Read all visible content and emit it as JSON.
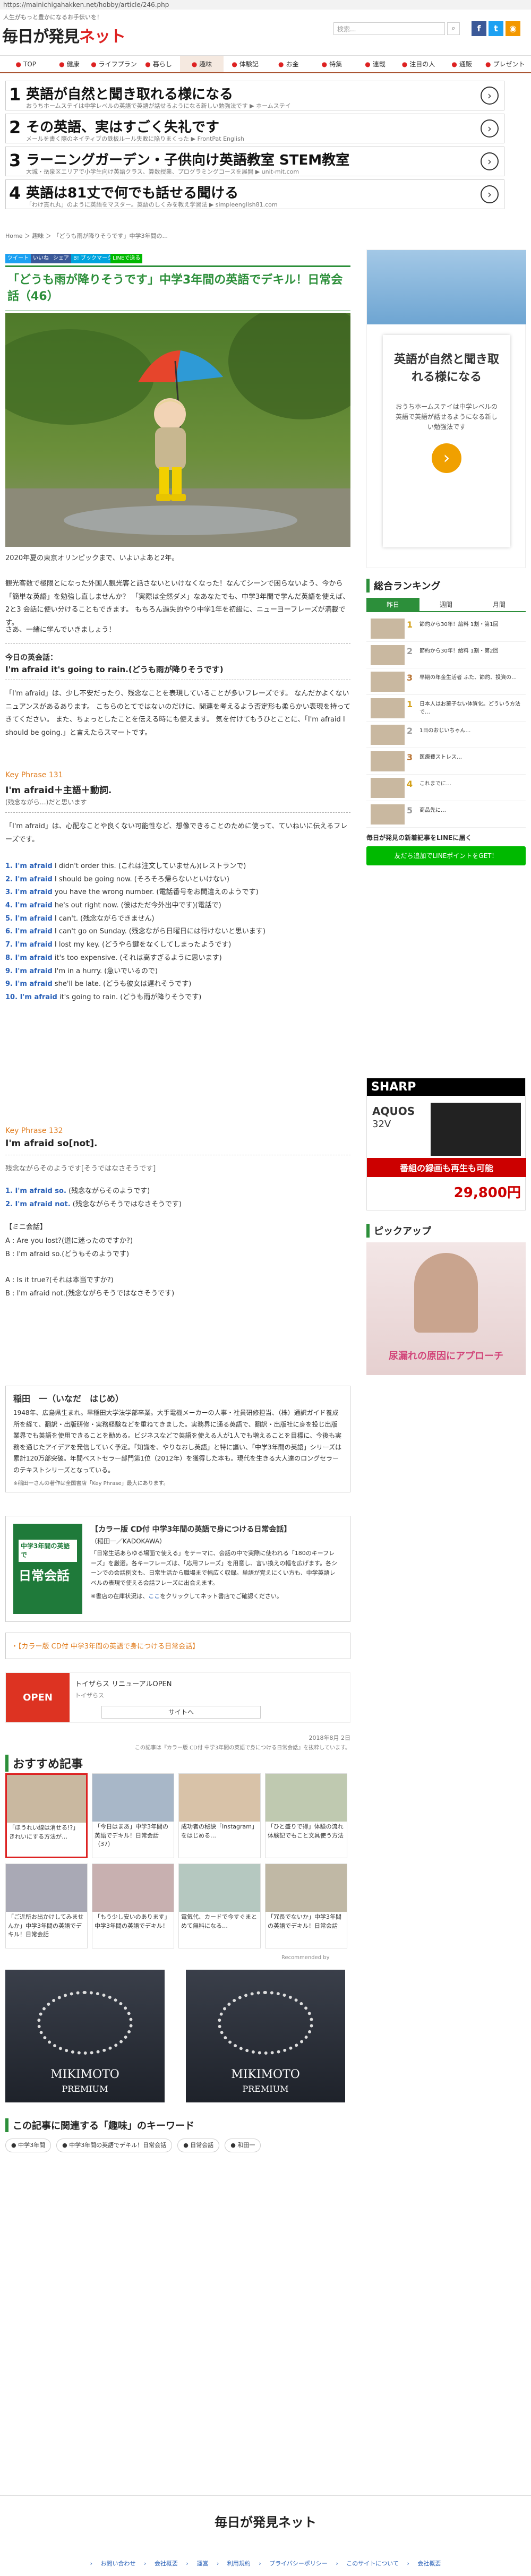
{
  "browser": {
    "url": "https://mainichigahakken.net/hobby/article/246.php"
  },
  "header": {
    "tagline": "人生がもっと豊かになるお手伝いを！",
    "logo_main": "毎日が発見",
    "logo_net": "ネット",
    "search_placeholder": "検索..."
  },
  "nav": {
    "items": [
      "TOP",
      "健康",
      "ライフプラン",
      "暮らし",
      "趣味",
      "体験記",
      "お金",
      "特集",
      "連載",
      "注目の人",
      "通販",
      "プレゼント"
    ],
    "active_index": 4
  },
  "ads": [
    {
      "num": "1",
      "title": "英語が自然と聞き取れる様になる",
      "sub": "おうちホームステイは中学レベルの英語で英語が話せるようになる新しい勉強法です ▶ ホームステイ"
    },
    {
      "num": "2",
      "title": "その英語、実はすごく失礼です",
      "sub": "メールを書く際のネイティブの鉄板ルール失敗に陥りまくった ▶ FrontPat English"
    },
    {
      "num": "3",
      "title": "ラーニングガーデン・子供向け英語教室 STEM教室",
      "sub": "大城・岳泉区エリアで小学生向け英語クラス、算数授業、プログラミングコースを展開 ▶ unit-mit.com"
    },
    {
      "num": "4",
      "title": "英語は81丈で何でも話せる聞ける",
      "sub": "「わけ貫れ丸」のように英語をマスター。英語のしくみを教え学習法 ▶ simpleenglish81.com"
    }
  ],
  "breadcrumb": "Home ＞ 趣味 ＞ 「どうも雨が降りそうです」中学3年間の...",
  "share": {
    "tweet": "ツイート",
    "like": "いいね",
    "share": "シェア",
    "hatena": "B! ブックマーク",
    "line": "LINEで送る"
  },
  "article": {
    "title": "「どうも雨が降りそうです」中学3年間の英語でデキル！日常会話（46）",
    "intro1": "2020年夏の東京オリンピックまで、いよいよあと2年。",
    "intro2": "観光客数で極限とになった外国人観光客と話さないといけなくなった！なんてシーンで困らないよう、今から「簡単な英語」を勉強し直しませんか？ 「実際は全然ダメ」なあなたでも、中学3年間で学んだ英語を使えば、2と3 会話に使い分けることもできます。 もちろん過失的やり中学1年を初級に、ニューヨーフレーズが満載です。",
    "intro3": "さあ、一緒に学んでいきましょう！",
    "today_label": "今日の英会話：",
    "today_phrase": "I'm afraid it's going to rain.(どうも雨が降りそうです)",
    "expl1": "「I'm afraid」は、少し不安だったり、残念なことを表現していることが多いフレーズです。 なんだかよくないニュアンスがあるあります。 こちらのとてではないのだけに、関連を考えるよう否定形も柔らかい表現を持ってきてください。 また、ちょっとしたことを伝える時にも使えます。 気を付けてもうひとことに、「I'm afraid I should be going.」と言えたらスマートです。",
    "kp131": "Key Phrase 131",
    "kp131_head": "I'm afraid＋主語＋動詞.",
    "kp131_sub": "(残念ながら…)だと思います",
    "kp131_expl": "「I'm afraid」は、心配なことや良くない可能性など、想像できることのために使って、ていねいに伝えるフレーズです。",
    "examples131": [
      {
        "num": "1.",
        "en": "I'm afraid",
        "rest": " I didn't order this. (これは注文していません)(レストランで)"
      },
      {
        "num": "2.",
        "en": "I'm afraid",
        "rest": " I should be going now. (そろそろ帰らないといけない)"
      },
      {
        "num": "3.",
        "en": "I'm afraid",
        "rest": " you have the wrong number. (電話番号をお間違えのようです)"
      },
      {
        "num": "4.",
        "en": "I'm afraid",
        "rest": " he's out right now. (彼はただ今外出中です)(電話で)"
      },
      {
        "num": "5.",
        "en": "I'm afraid",
        "rest": " I can't. (残念ながらできません)"
      },
      {
        "num": "6.",
        "en": "I'm afraid",
        "rest": " I can't go on Sunday. (残念ながら日曜日には行けないと思います)"
      },
      {
        "num": "7.",
        "en": "I'm afraid",
        "rest": " I lost my key. (どうやら鍵をなくしてしまったようです)"
      },
      {
        "num": "8.",
        "en": "I'm afraid",
        "rest": " it's too expensive. (それは高すぎるように思います)"
      },
      {
        "num": "9.",
        "en": "I'm afraid",
        "rest": " I'm in a hurry. (急いでいるので)"
      },
      {
        "num": "9.",
        "en": "I'm afraid",
        "rest": " she'll be late. (どうも彼女は遅れそうです)"
      },
      {
        "num": "10.",
        "en": "I'm afraid",
        "rest": " it's going to rain. (どうも雨が降りそうです)"
      }
    ],
    "kp132": "Key Phrase 132",
    "kp132_head": "I'm afraid so[not].",
    "kp132_sub": "残念ながらそのようです[そうではなさそうです]",
    "examples132": [
      {
        "num": "1.",
        "en": "I'm afraid so.",
        "rest": " (残念ながらそのようです)"
      },
      {
        "num": "2.",
        "en": "I'm afraid not.",
        "rest": " (残念ながらそうではなさそうです)"
      }
    ],
    "dialog_label": "【ミニ会話】",
    "dialog": [
      "A : Are you lost?(道に迷ったのですか?)",
      "B : I'm afraid so.(どうもそのようです)",
      "",
      "A : Is it true?(それは本当ですか?)",
      "B : I'm afraid not.(残念ながらそうではなさそうです)"
    ]
  },
  "author": {
    "name": "稲田　一（いなだ　はじめ）",
    "bio": "1948年、広島県生まれ。早稲田大学法学部卒業。大手電機メーカーの人事・社員研修担当、（株）通訳ガイド養成所を経て、翻訳・出版研修・実務経験などを重ねてきました。実務界に通る英語で、翻訳・出版社に身を投じ出版業界でも英語を使用できることを勧める。ビジネスなどで英語を使える人が1人でも増えることを目標に、今後も実務を通じたアイデアを発信していく予定。「知識を、やりなおし英語」と特に謳い、「中学3年間の英語」シリーズは累計120万部突破。年間ベストセラー部門第1位（2012年）を獲得した本も。現代を生きる大人達のロングセラーのテキストシリーズとなっている。",
    "note": "※稲田一さんの著作は全国書店「Key Phrase」最大にあります。"
  },
  "book": {
    "title": "【カラー版 CD付 中学3年間の英語で身につける日常会話】",
    "meta": "（稲田一／KADOKAWA）",
    "desc": "「日常生活あらゆる場面で使える」をテーマに、会話の中で実際に使われる「180のキーフレーズ」を厳選。各キーフレーズは、「応用フレーズ」を用意し、言い換えの幅を広げます。各シーンでの会話例文も、日常生活から職場まで幅広く収録。単語が覚えにくい方も、中学英語レベルの表現で使える会話フレーズに出会えます。",
    "link_pre": "※書店の在庫状況は、",
    "link": "ここ",
    "link_post": "をクリックしてネット書店でご確認ください。"
  },
  "related_link": "・【カラー版 CD付 中学3年間の英語で身につける日常会話】",
  "banner": {
    "title": "トイザらス リニューアルOPEN",
    "sub": "トイザらス",
    "cta": "サイトへ"
  },
  "date": "2018年8月 2日",
  "date_note": "この記事は『カラー版 CD付 中学3年間の英語で身につける日常会話』を抜粋しています。",
  "recommend": {
    "title": "おすすめ記事",
    "items": [
      "「ほうれい線は消せる!?」きれいにする方法が…",
      "「今日はまあ」中学3年間の英語でデキル！日常会話（37）",
      "成功者の秘訣「Instagram」をはじめる…",
      "「ひと盛りで得」体験の流れ体験記でもこと文具使う方法",
      "「ご近所お出かけしてみませんか」中学3年間の英語でデキル！日常会話",
      "「もう少し安いのあります」中学3年間の英語でデキル！",
      "電気代、カードで今すぐまとめて無料になる…",
      "「冗長でないか」中学3年間の英語でデキル！日常会話"
    ],
    "footer": "Recommended by"
  },
  "luxury_ads": [
    {
      "brand": "MIKIMOTO",
      "sub": "PREMIUM"
    },
    {
      "brand": "MIKIMOTO",
      "sub": "PREMIUM"
    }
  ],
  "keywords": {
    "title": "この記事に関連する「趣味」のキーワード",
    "items": [
      "中学3年間",
      "中学3年間の英語でデキル！日常会話",
      "日常会話",
      "和田一"
    ]
  },
  "side_ad": {
    "headline": "英語が自然と聞き取れる様になる",
    "body": "おうちホームステイは中学レベルの英語で英語が話せるようになる新しい勉強法です",
    "cta": "›"
  },
  "ranking": {
    "title": "総合ランキング",
    "tabs": [
      "昨日",
      "週間",
      "月間"
    ],
    "items": [
      {
        "rank": "1",
        "text": "節約から30年！給料 1割・第1回"
      },
      {
        "rank": "2",
        "text": "節約から30年！給料 1割・第2回"
      },
      {
        "rank": "3",
        "text": "早期の年金生活者 ふた、節約、投資の…"
      },
      {
        "rank": "1",
        "text": "日本人はお菓子ない体質化。どういう方法で…"
      },
      {
        "rank": "2",
        "text": "1日のおじいちゃん…"
      },
      {
        "rank": "3",
        "text": "医療費ストレス…"
      },
      {
        "rank": "4",
        "text": "これまでに…"
      },
      {
        "rank": "5",
        "text": "商品先に…"
      }
    ],
    "more": "毎日が発見の新着記事をLINEに届く",
    "line_cta": "友だち追加でLINEポイントをGET！"
  },
  "sharp_ad": {
    "brand": "SHARP",
    "model": "AQUOS",
    "size": "32V",
    "headline": "番組の録画も再生も可能",
    "price": "29,800円"
  },
  "pickup": {
    "title": "ピックアップ",
    "caption": "尿漏れの原因にアプローチ"
  },
  "footer": {
    "logo": "毎日が発見ネット",
    "links": [
      "お問い合わせ",
      "会社概要",
      "運営",
      "利用規約",
      "プライバシーポリシー",
      "このサイトについて",
      "会社概要"
    ]
  },
  "colors": {
    "accent": "#2c8f3a",
    "nav_border": "#a53",
    "keyphrase": "#e07b1c",
    "link": "#2a61b8"
  }
}
